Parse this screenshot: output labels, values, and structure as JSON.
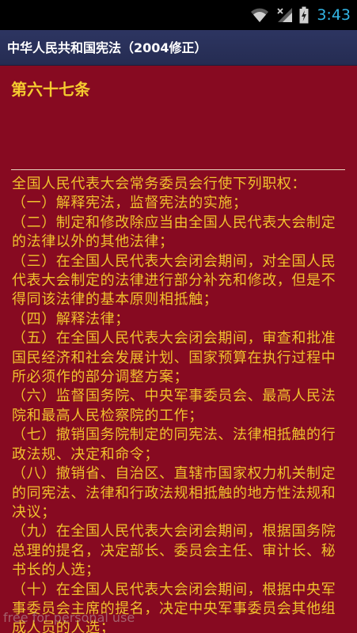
{
  "status_bar": {
    "time": "3:43",
    "icons": [
      "wifi-icon",
      "signal-icon",
      "battery-icon"
    ],
    "time_color": "#33b5e5"
  },
  "app": {
    "title": "中华人民共和国宪法（2004修正）"
  },
  "article": {
    "title": "第六十七条",
    "paragraphs": [
      "全国人民代表大会常务委员会行使下列职权：",
      "（一）解释宪法，监督宪法的实施；",
      "（二）制定和修改除应当由全国人民代表大会制定的法律以外的其他法律；",
      "（三）在全国人民代表大会闭会期间，对全国人民代表大会制定的法律进行部分补充和修改，但是不得同该法律的基本原则相抵触；",
      "（四）解释法律；",
      "（五）在全国人民代表大会闭会期间，审查和批准国民经济和社会发展计划、国家预算在执行过程中所必须作的部分调整方案；",
      "（六）监督国务院、中央军事委员会、最高人民法院和最高人民检察院的工作；",
      "（七）撤销国务院制定的同宪法、法律相抵触的行政法规、决定和命令；",
      "（八）撤销省、自治区、直辖市国家权力机关制定的同宪法、法律和行政法规相抵触的地方性法规和决议；",
      "（九）在全国人民代表大会闭会期间，根据国务院总理的提名，决定部长、委员会主任、审计长、秘书长的人选；",
      "（十）在全国人民代表大会闭会期间，根据中央军事委员会主席的提名，决定中央军事委员会其他组成人员的人选；"
    ]
  },
  "watermark": "free for personal use",
  "colors": {
    "background": "#870a21",
    "text": "#f0c22e",
    "title_bar": "#2d3561"
  }
}
